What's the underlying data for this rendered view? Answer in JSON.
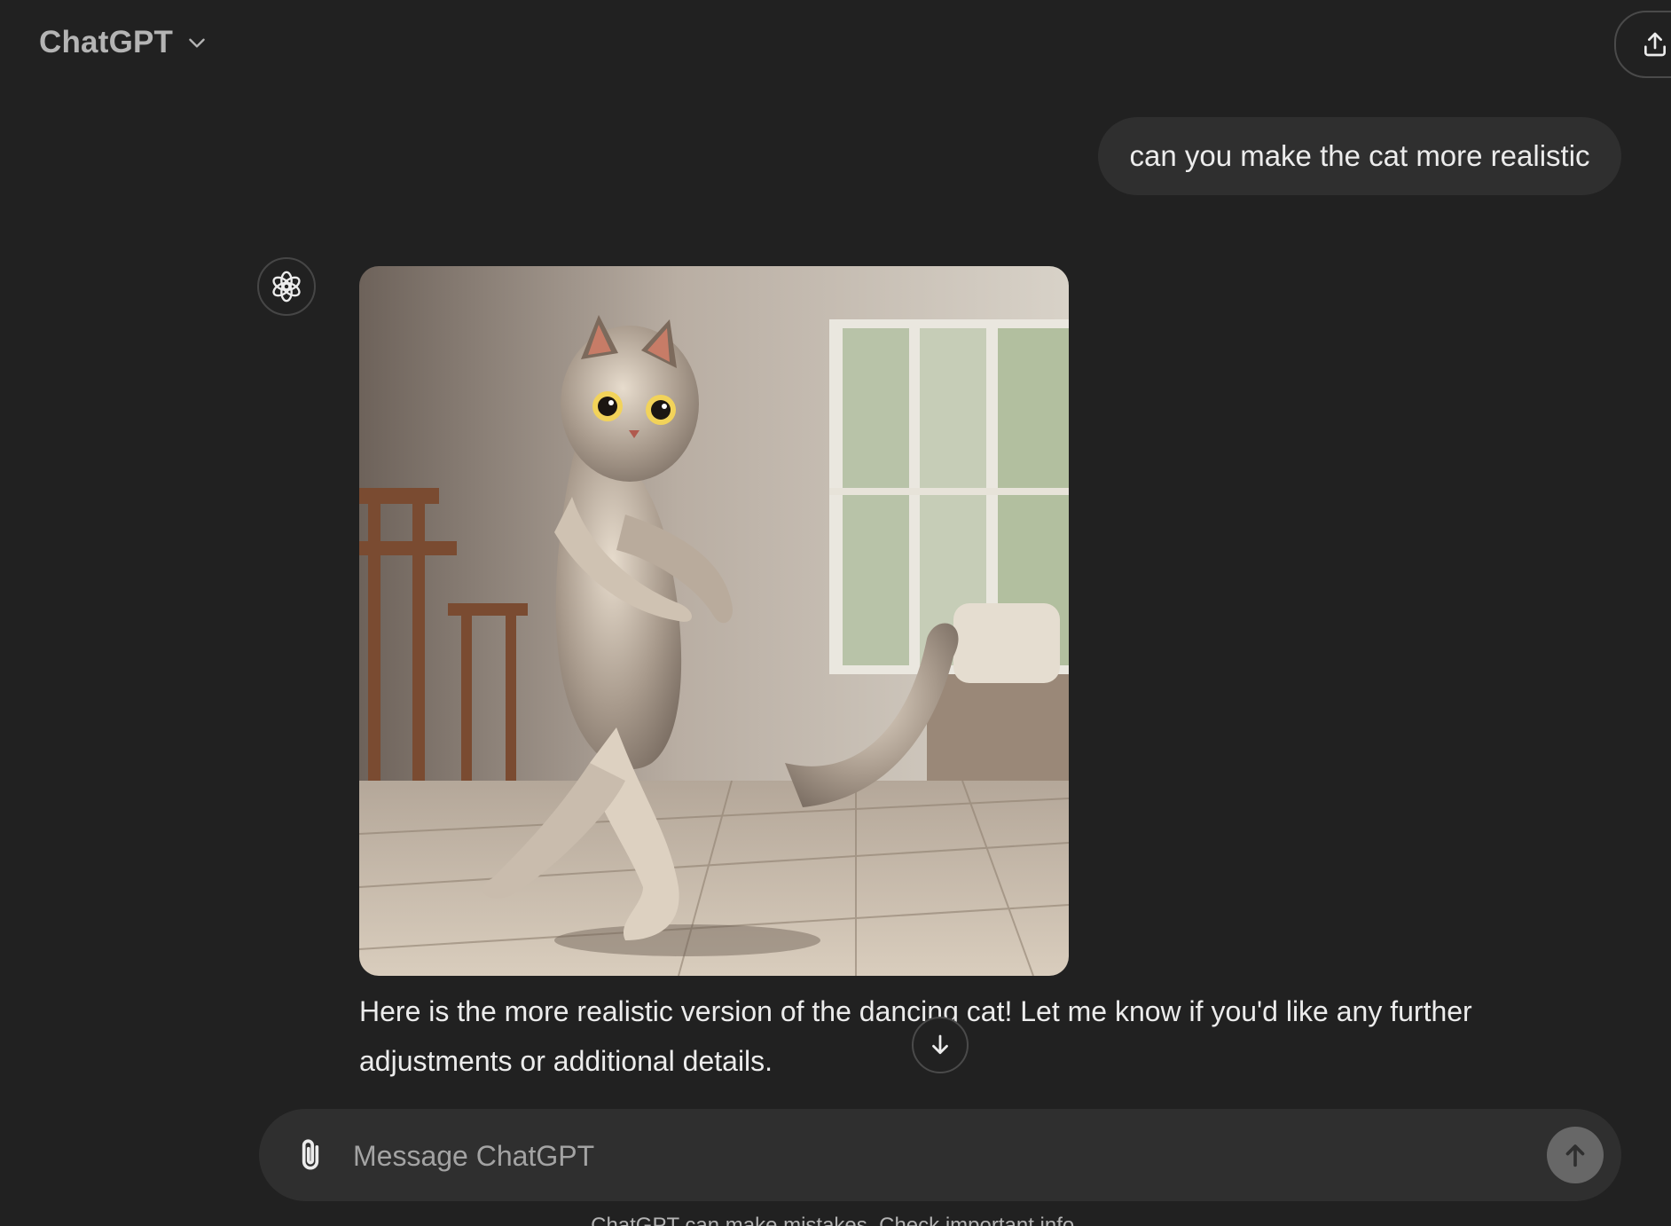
{
  "header": {
    "model_name": "ChatGPT",
    "model_icon": "chevron-down-icon",
    "share_icon": "share-icon"
  },
  "conversation": {
    "user_message": "can you make the cat more realistic",
    "assistant": {
      "avatar_icon": "openai-logo-icon",
      "image_subject": "realistic-dancing-cat-image",
      "text": "Here is the more realistic version of the dancing cat! Let me know if you'd like any further adjustments or additional details."
    },
    "scroll_icon": "arrow-down-icon"
  },
  "composer": {
    "placeholder": "Message ChatGPT",
    "value": "",
    "attach_icon": "paperclip-icon",
    "send_icon": "arrow-up-icon"
  },
  "footer": {
    "disclaimer": "ChatGPT can make mistakes. Check important info."
  },
  "colors": {
    "background": "#212121",
    "surface": "#2f2f2f",
    "text": "#ececec",
    "muted": "#b4b4b4"
  }
}
